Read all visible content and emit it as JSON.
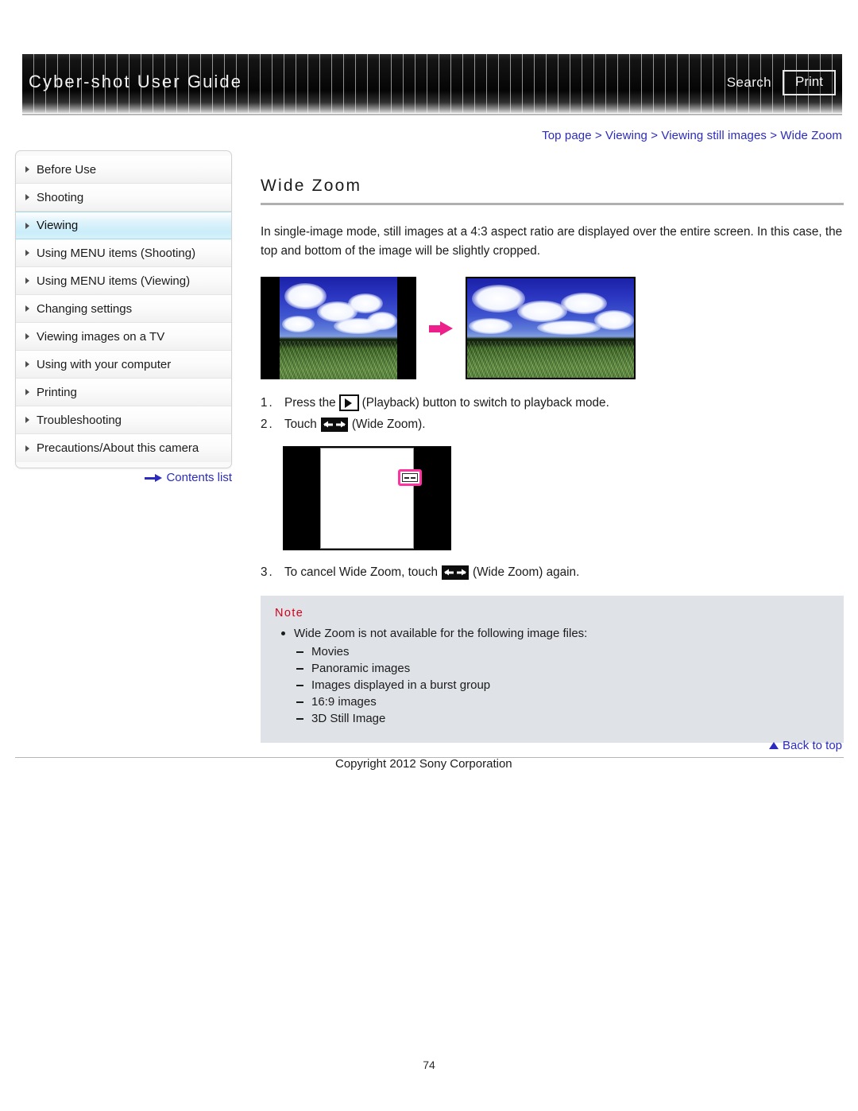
{
  "header": {
    "brand_title": "Cyber-shot User Guide",
    "search_label": "Search",
    "print_label": "Print"
  },
  "breadcrumb": {
    "full": "Top page > Viewing > Viewing still images > Wide Zoom",
    "items": [
      "Top page",
      "Viewing",
      "Viewing still images",
      "Wide Zoom"
    ],
    "separator": ">",
    "link_color": "#2b2bbf"
  },
  "sidebar": {
    "items": [
      {
        "label": "Before Use",
        "active": false
      },
      {
        "label": "Shooting",
        "active": false
      },
      {
        "label": "Viewing",
        "active": true
      },
      {
        "label": "Using MENU items (Shooting)",
        "active": false
      },
      {
        "label": "Using MENU items (Viewing)",
        "active": false
      },
      {
        "label": "Changing settings",
        "active": false
      },
      {
        "label": "Viewing images on a TV",
        "active": false
      },
      {
        "label": "Using with your computer",
        "active": false
      },
      {
        "label": "Printing",
        "active": false
      },
      {
        "label": "Troubleshooting",
        "active": false
      },
      {
        "label": "Precautions/About this camera",
        "active": false
      }
    ],
    "contents_link": "Contents list",
    "active_highlight_color": "#c9edfa"
  },
  "main": {
    "title": "Wide Zoom",
    "intro": "In single-image mode, still images at a 4:3 aspect ratio are displayed over the entire screen. In this case, the top and bottom of the image will be slightly cropped.",
    "steps": [
      {
        "number": "1.",
        "text_before": "Press the",
        "icon": "playback-icon",
        "text_after": "(Playback) button to switch to playback mode."
      },
      {
        "number": "2.",
        "text_before": "Touch",
        "icon": "wide-zoom-icon",
        "text_after": "(Wide Zoom)."
      },
      {
        "number": "3.",
        "text_before": "To cancel Wide Zoom, touch",
        "icon": "wide-zoom-icon",
        "text_after": "(Wide Zoom) again."
      }
    ]
  },
  "note": {
    "title": "Note",
    "bullet": "Wide Zoom is not available for the following image files:",
    "sub_items": [
      "Movies",
      "Panoramic images",
      "Images displayed in a burst group",
      "16:9 images",
      "3D Still Image"
    ],
    "background_color": "#dfe2e7",
    "title_color": "#d0021b"
  },
  "footer": {
    "back_to_top": "Back to top",
    "copyright": "Copyright 2012 Sony Corporation",
    "page_number": "74"
  }
}
